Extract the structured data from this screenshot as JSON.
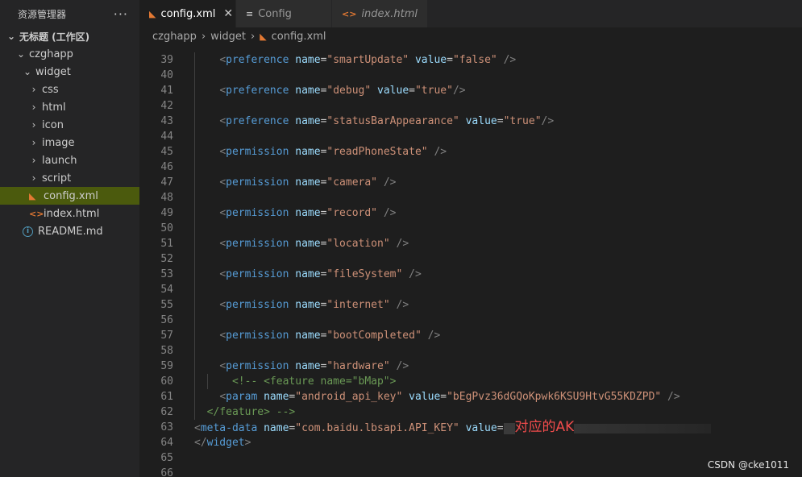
{
  "sidebar": {
    "title": "资源管理器",
    "more": "···",
    "workspace": "无标题 (工作区)",
    "project": "czghapp",
    "widget": "widget",
    "folders": [
      "css",
      "html",
      "icon",
      "image",
      "launch",
      "script"
    ],
    "files": [
      {
        "name": "config.xml",
        "icon": "rss-icon",
        "selected": true
      },
      {
        "name": "index.html",
        "icon": "html-icon",
        "selected": false
      }
    ],
    "readme": "README.md"
  },
  "tabs": [
    {
      "label": "config.xml",
      "icon": "rss-icon",
      "active": true
    },
    {
      "label": "Config",
      "icon": "document-icon",
      "active": false
    },
    {
      "label": "index.html",
      "icon": "html-icon",
      "active": false
    }
  ],
  "breadcrumb": {
    "parts": [
      "czghapp",
      "widget",
      "config.xml"
    ]
  },
  "editor": {
    "lines": [
      {
        "n": "39",
        "code": "    <preference name=\"smartUpdate\" value=\"false\" />"
      },
      {
        "n": "40",
        "code": ""
      },
      {
        "n": "41",
        "code": "    <preference name=\"debug\" value=\"true\"/>"
      },
      {
        "n": "42",
        "code": ""
      },
      {
        "n": "43",
        "code": "    <preference name=\"statusBarAppearance\" value=\"true\"/>"
      },
      {
        "n": "44",
        "code": ""
      },
      {
        "n": "45",
        "code": "    <permission name=\"readPhoneState\" />"
      },
      {
        "n": "46",
        "code": ""
      },
      {
        "n": "47",
        "code": "    <permission name=\"camera\" />"
      },
      {
        "n": "48",
        "code": ""
      },
      {
        "n": "49",
        "code": "    <permission name=\"record\" />"
      },
      {
        "n": "50",
        "code": ""
      },
      {
        "n": "51",
        "code": "    <permission name=\"location\" />"
      },
      {
        "n": "52",
        "code": ""
      },
      {
        "n": "53",
        "code": "    <permission name=\"fileSystem\" />"
      },
      {
        "n": "54",
        "code": ""
      },
      {
        "n": "55",
        "code": "    <permission name=\"internet\" />"
      },
      {
        "n": "56",
        "code": ""
      },
      {
        "n": "57",
        "code": "    <permission name=\"bootCompleted\" />"
      },
      {
        "n": "58",
        "code": ""
      },
      {
        "n": "59",
        "code": "    <permission name=\"hardware\" />"
      },
      {
        "n": "60",
        "code": "      <!-- <feature name=\"bMap\">"
      },
      {
        "n": "61",
        "code": "    <param name=\"android_api_key\" value=\"bEgPvz36dGQoKpwk6KSU9HtvG55KDZPD\" />"
      },
      {
        "n": "62",
        "code": "  </feature> -->"
      },
      {
        "n": "63",
        "code": "<meta-data name=\"com.baidu.lbsapi.API_KEY\" value="
      },
      {
        "n": "64",
        "code": "</widget>"
      },
      {
        "n": "65",
        "code": ""
      },
      {
        "n": "66",
        "code": ""
      }
    ],
    "annotation": "对应的AK"
  },
  "watermark": "CSDN @cke1011"
}
